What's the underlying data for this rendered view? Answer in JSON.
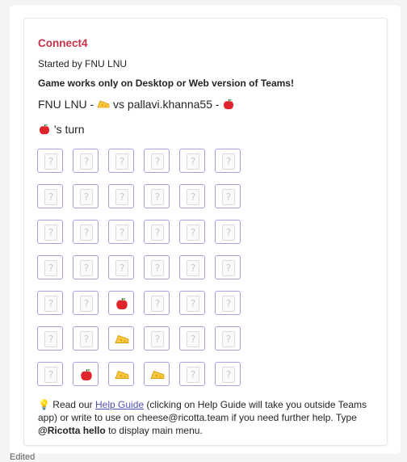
{
  "card": {
    "title": "Connect4",
    "started_by": "Started by FNU LNU",
    "warning": "Game works only on Desktop or Web version of Teams!",
    "player1_name": "FNU LNU -",
    "vs_text": "vs pallavi.khanna55 -",
    "turn_text": "'s turn",
    "player1_piece": "cheese-icon",
    "player2_piece": "apple-icon",
    "current_turn_piece": "apple-icon"
  },
  "board": {
    "rows": [
      [
        "empty",
        "empty",
        "empty",
        "empty",
        "empty",
        "empty"
      ],
      [
        "empty",
        "empty",
        "empty",
        "empty",
        "empty",
        "empty"
      ],
      [
        "empty",
        "empty",
        "empty",
        "empty",
        "empty",
        "empty"
      ],
      [
        "empty",
        "empty",
        "empty",
        "empty",
        "empty",
        "empty"
      ],
      [
        "empty",
        "empty",
        "apple",
        "empty",
        "empty",
        "empty"
      ],
      [
        "empty",
        "empty",
        "cheese",
        "empty",
        "empty",
        "empty"
      ],
      [
        "empty",
        "apple",
        "cheese",
        "cheese",
        "empty",
        "empty"
      ]
    ],
    "empty_glyph": "?"
  },
  "footer": {
    "bulb_icon": "lightbulb-icon",
    "read_prefix": "Read our",
    "help_link": "Help Guide",
    "after_link": "(clicking on Help Guide will take you outside Teams app) or write to use on cheese@ricotta.team if you need further help. Type",
    "command": "@Ricotta hello",
    "suffix": "to display main menu."
  },
  "edited_label": "Edited"
}
